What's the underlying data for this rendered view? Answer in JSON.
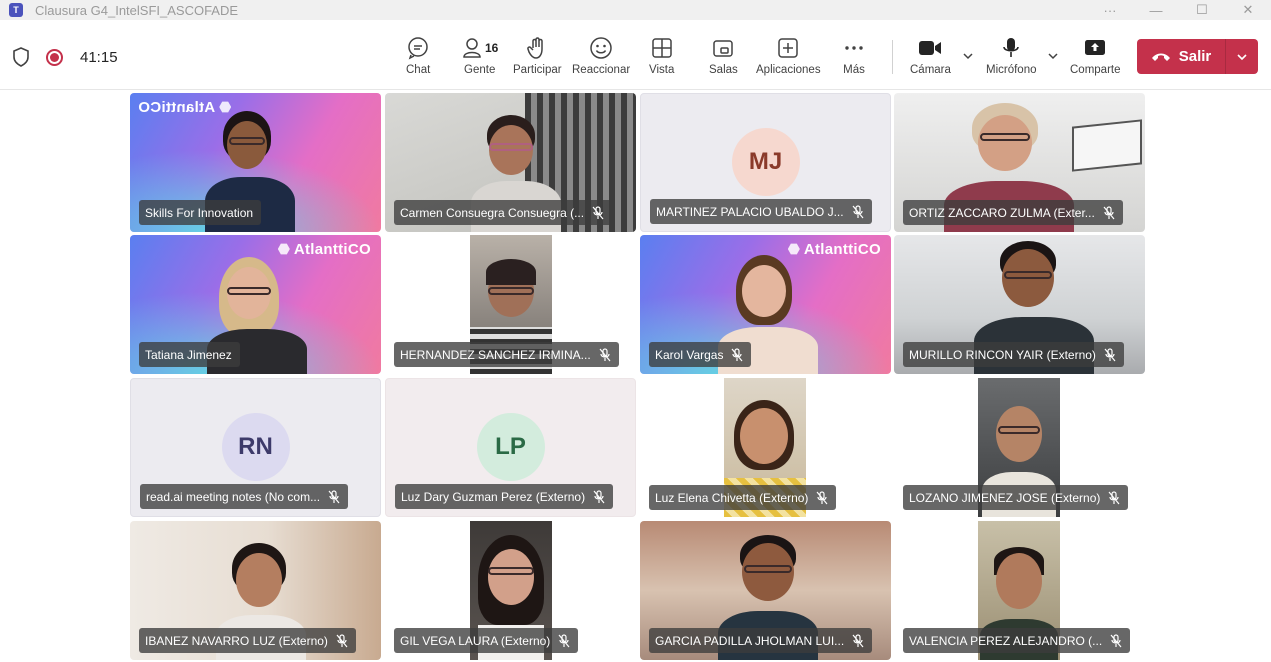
{
  "window": {
    "title": "Clausura G4_IntelSFI_ASCOFADE"
  },
  "toolbar": {
    "timer": "41:15",
    "chat": "Chat",
    "people": "Gente",
    "people_count": "16",
    "raise": "Participar",
    "react": "Reaccionar",
    "view": "Vista",
    "rooms": "Salas",
    "apps": "Aplicaciones",
    "more": "Más",
    "camera": "Cámara",
    "mic": "Micrófono",
    "share": "Comparte",
    "leave": "Salir"
  },
  "tiles": [
    {
      "name": "Skills For Innovation",
      "muted": false
    },
    {
      "name": "Carmen Consuegra Consuegra (...",
      "muted": true
    },
    {
      "name": "MARTINEZ PALACIO UBALDO J...",
      "muted": true,
      "initials": "MJ"
    },
    {
      "name": "ORTIZ ZACCARO ZULMA (Exter...",
      "muted": true
    },
    {
      "name": "Tatiana Jimenez",
      "muted": false
    },
    {
      "name": "HERNANDEZ SANCHEZ IRMINA...",
      "muted": true
    },
    {
      "name": "Karol Vargas",
      "muted": true
    },
    {
      "name": "MURILLO RINCON YAIR (Externo)",
      "muted": true
    },
    {
      "name": "read.ai meeting notes (No com...",
      "muted": true,
      "initials": "RN"
    },
    {
      "name": "Luz Dary Guzman Perez (Externo)",
      "muted": true,
      "initials": "LP"
    },
    {
      "name": "Luz Elena Chivetta (Externo)",
      "muted": true
    },
    {
      "name": "LOZANO JIMENEZ JOSE (Externo)",
      "muted": true
    },
    {
      "name": "IBANEZ NAVARRO LUZ (Externo)",
      "muted": true
    },
    {
      "name": "GIL VEGA LAURA (Externo)",
      "muted": true
    },
    {
      "name": "GARCIA PADILLA JHOLMAN LUI...",
      "muted": true
    },
    {
      "name": "VALENCIA PEREZ ALEJANDRO (...",
      "muted": true
    }
  ],
  "branding": {
    "logo": "AtlanttiCO"
  },
  "colors": {
    "leave": "#c4314b",
    "mj_avatar": "#f6d8cf",
    "rn_avatar": "#dcdaf0",
    "lp_avatar": "#d3ecdd"
  }
}
